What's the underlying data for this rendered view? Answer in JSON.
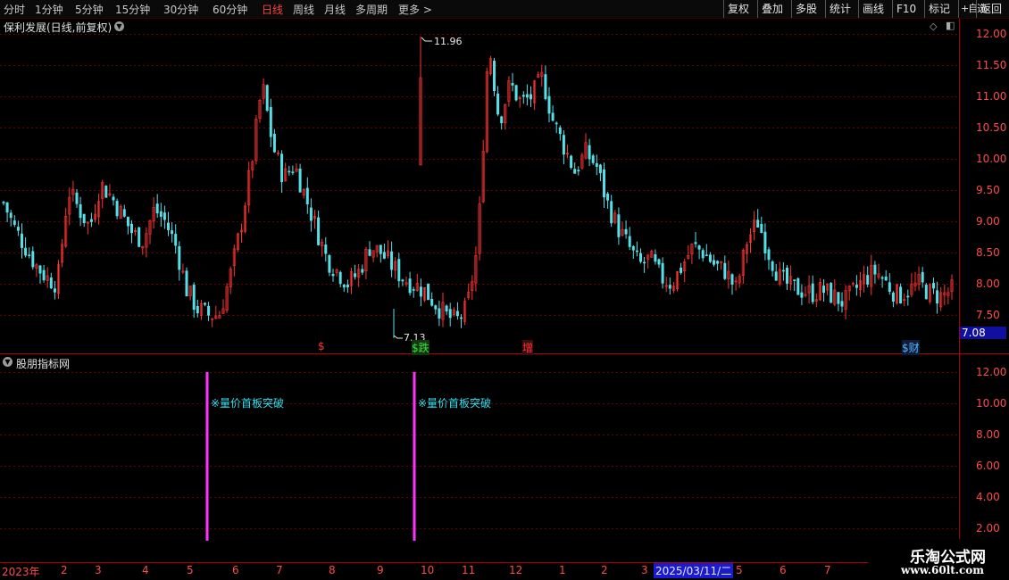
{
  "toolbar": {
    "timeframes": [
      "分时",
      "1分钟",
      "5分钟",
      "15分钟",
      "30分钟",
      "60分钟",
      "日线",
      "周线",
      "月线",
      "多周期",
      "更多 >"
    ],
    "active_timeframe": "日线",
    "right_buttons": [
      "复权",
      "叠加",
      "多股",
      "统计",
      "画线",
      "F10",
      "标记",
      "+自选",
      "返回"
    ]
  },
  "main_chart": {
    "title": "保利发展(日线,前复权)",
    "price_ticks": [
      "12.00",
      "11.50",
      "11.00",
      "10.50",
      "10.00",
      "9.50",
      "9.00",
      "8.50",
      "8.00",
      "7.50"
    ],
    "current_price": "7.08",
    "high_label": "11.96",
    "low_label": "7.13",
    "event_tags": [
      {
        "text": "$",
        "color": "#ff3030"
      },
      {
        "text": "$跌",
        "color": "#3de03d"
      },
      {
        "text": "增",
        "color": "#ff3030"
      },
      {
        "text": "$财",
        "color": "#5ab0ff"
      }
    ],
    "colors": {
      "up": "#ff3333",
      "down": "#54e0e8",
      "grid": "#6b0000",
      "axis": "#b00000"
    }
  },
  "sub_chart": {
    "title": "股朋指标网",
    "ticks": [
      "12.00",
      "10.00",
      "8.00",
      "6.00",
      "4.00",
      "2.00"
    ],
    "signals": [
      {
        "label": "※量价首板突破",
        "color": "#ff33ff"
      },
      {
        "label": "※量价首板突破",
        "color": "#ff33ff"
      }
    ]
  },
  "x_axis": {
    "labels": [
      "2023年",
      "2",
      "3",
      "4",
      "5",
      "6",
      "7",
      "8",
      "9",
      "10",
      "11",
      "12",
      "1",
      "2",
      "3",
      "5",
      "6",
      "7"
    ],
    "cursor_date": "2025/03/11/二"
  },
  "watermark": {
    "line1": "乐淘公式网",
    "line2": "www.60lt.com"
  },
  "chart_data": {
    "type": "candlestick",
    "title": "保利发展(日线,前复权)",
    "ylim": [
      7.2,
      12.2
    ],
    "highest": 11.96,
    "lowest": 7.13,
    "close_series_approx": [
      9.3,
      8.9,
      8.6,
      8.3,
      8.1,
      8.0,
      9.5,
      9.2,
      8.9,
      9.6,
      9.4,
      9.1,
      8.8,
      8.7,
      9.2,
      9.0,
      8.6,
      7.9,
      7.6,
      7.5,
      7.5,
      8.1,
      8.9,
      9.9,
      11.2,
      10.2,
      9.7,
      9.9,
      9.4,
      8.9,
      8.4,
      8.2,
      8.0,
      8.2,
      8.6,
      8.5,
      8.3,
      8.1,
      8.0,
      7.9,
      7.7,
      7.5,
      7.4,
      7.6,
      8.6,
      11.9,
      10.6,
      11.2,
      10.9,
      11.0,
      11.3,
      10.6,
      10.2,
      9.8,
      10.1,
      9.9,
      9.3,
      8.9,
      8.6,
      8.3,
      8.4,
      8.1,
      8.0,
      8.3,
      8.6,
      8.5,
      8.3,
      8.2,
      7.9,
      8.7,
      9.0,
      8.5,
      8.1,
      7.95,
      7.9,
      7.85,
      7.9,
      7.8,
      7.7,
      7.9,
      8.1,
      8.2,
      8.0,
      7.8,
      7.9,
      8.0,
      7.85,
      7.8,
      7.9
    ],
    "indicator": {
      "name": "股朋指标网",
      "ylim": [
        1.2,
        12.6
      ],
      "signals": [
        "※量价首板突破",
        "※量价首板突破"
      ],
      "signal_value": 12.0
    }
  }
}
